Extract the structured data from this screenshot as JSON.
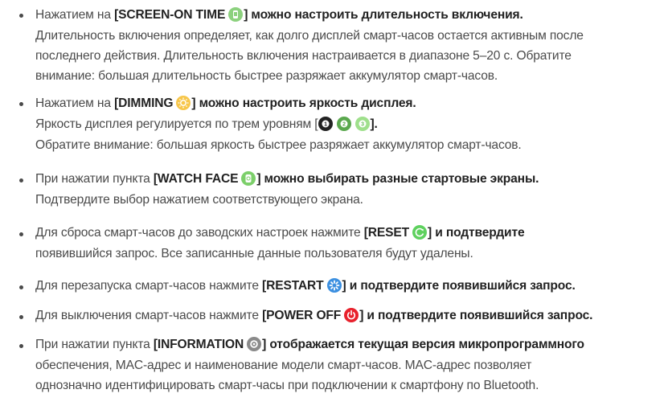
{
  "items": [
    {
      "keyword": "SCREEN-ON TIME",
      "after": "] можно настроить длительность включения.",
      "prefix": "Нажатием на ",
      "lines": [
        "Длительность включения определяет, как долго дисплей смарт-часов остается активным после",
        "последнего действия. Длительность включения настраивается в диапазоне 5–20 с. Обратите",
        "внимание: большая длительность быстрее разряжает аккумулятор смарт-часов."
      ],
      "icon": "screen-on-time-icon",
      "icon_color": "#8cd17e"
    },
    {
      "prefix": "Нажатием на ",
      "keyword": "DIMMING",
      "after": "] можно настроить яркость дисплея.",
      "line2_prefix": "Яркость дисплея регулируется по трем уровням [",
      "line2_after": "].",
      "lines": [
        "Обратите внимание: большая яркость быстрее разряжает аккумулятор смарт-часов."
      ],
      "icon": "dimming-sun-icon",
      "icon_color": "#f5b52e",
      "levels": [
        "1",
        "2",
        "3"
      ]
    },
    {
      "prefix": "При нажатии пункта ",
      "keyword": "WATCH FACE",
      "after": "] можно выбирать разные стартовые экраны.",
      "lines": [
        "Подтвердите выбор нажатием соответствующего экрана."
      ],
      "icon": "watch-face-icon",
      "icon_color": "#7ccf6a"
    },
    {
      "prefix": "Для сброса смарт-часов до заводских настроек нажмите ",
      "keyword": "RESET",
      "after": "] и подтвердите",
      "lines": [
        "появившийся запрос. Все записанные данные пользователя будут удалены."
      ],
      "icon": "reset-icon",
      "icon_color": "#5ed15e"
    },
    {
      "prefix": "Для перезапуска смарт-часов нажмите ",
      "keyword": "RESTART",
      "after": "] и подтвердите появившийся запрос.",
      "lines": [],
      "icon": "restart-icon",
      "icon_color": "#3b8fe0"
    },
    {
      "prefix": "Для выключения смарт-часов нажмите ",
      "keyword": "POWER OFF",
      "after": "] и подтвердите появившийся запрос.",
      "lines": [],
      "icon": "power-off-icon",
      "icon_color": "#e8212c"
    },
    {
      "prefix": "При нажатии пункта ",
      "keyword": "INFORMATION",
      "after": "] отображается текущая версия микропрограммного",
      "lines": [
        "обеспечения, MAC-адрес и наименование модели смарт-часов. MAC-адрес позволяет",
        "однозначно идентифицировать смарт-часы при подключении к смартфону по Bluetooth."
      ],
      "icon": "information-icon",
      "icon_color": "#8a8a8a"
    }
  ]
}
